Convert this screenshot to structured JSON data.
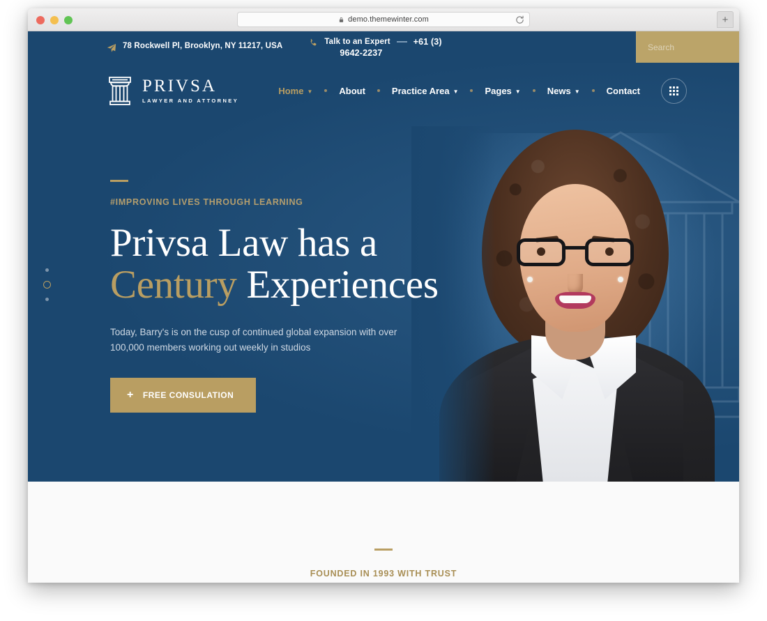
{
  "browser": {
    "url": "demo.themewinter.com",
    "lock_icon": "lock-icon",
    "reload_icon": "reload-icon",
    "newtab_label": "+",
    "traffic_lights": [
      "close",
      "minimize",
      "maximize"
    ]
  },
  "topbar": {
    "address_icon": "paper-plane-icon",
    "address": "78 Rockwell Pl, Brooklyn, NY 11217, USA",
    "phone_icon": "phone-icon",
    "phone_label": "Talk to an Expert",
    "phone_number_line1": "+61 (3)",
    "phone_number_line2": "9642-2237",
    "search_placeholder": "Search",
    "search_value": "",
    "search_icon": "search-icon"
  },
  "header": {
    "logo_icon": "column-pillar-icon",
    "logo_name": "PRIVSA",
    "logo_tagline": "LAWYER AND ATTORNEY",
    "nav": [
      {
        "label": "Home",
        "has_dropdown": true,
        "active": true
      },
      {
        "label": "About",
        "has_dropdown": false,
        "active": false
      },
      {
        "label": "Practice Area",
        "has_dropdown": true,
        "active": false
      },
      {
        "label": "Pages",
        "has_dropdown": true,
        "active": false
      },
      {
        "label": "News",
        "has_dropdown": true,
        "active": false
      },
      {
        "label": "Contact",
        "has_dropdown": false,
        "active": false
      }
    ],
    "grid_button_icon": "grid-menu-icon",
    "chevron_icon": "chevron-down-icon"
  },
  "hero": {
    "tagline": "#IMPROVING LIVES THROUGH LEARNING",
    "title_line1": "Privsa Law has a",
    "title_accent": "Century",
    "title_line2_rest": " Experiences",
    "subtitle": "Today, Barry's is on the cusp of continued global expansion with over 100,000 members working out weekly in studios",
    "cta_label": "FREE CONSULATION",
    "cta_icon": "plus-icon",
    "slider_dots": 3,
    "slider_active_index": 1,
    "portrait_alt": "Smiling woman lawyer with curly hair, glasses, white shirt and dark blazer"
  },
  "below": {
    "tagline": "FOUNDED IN 1993 WITH TRUST"
  },
  "colors": {
    "navy": "#1b476f",
    "gold": "#b99e62",
    "search_bg": "#bba469",
    "section_bg": "#fafafa",
    "muted_text": "#cfd9e4"
  }
}
